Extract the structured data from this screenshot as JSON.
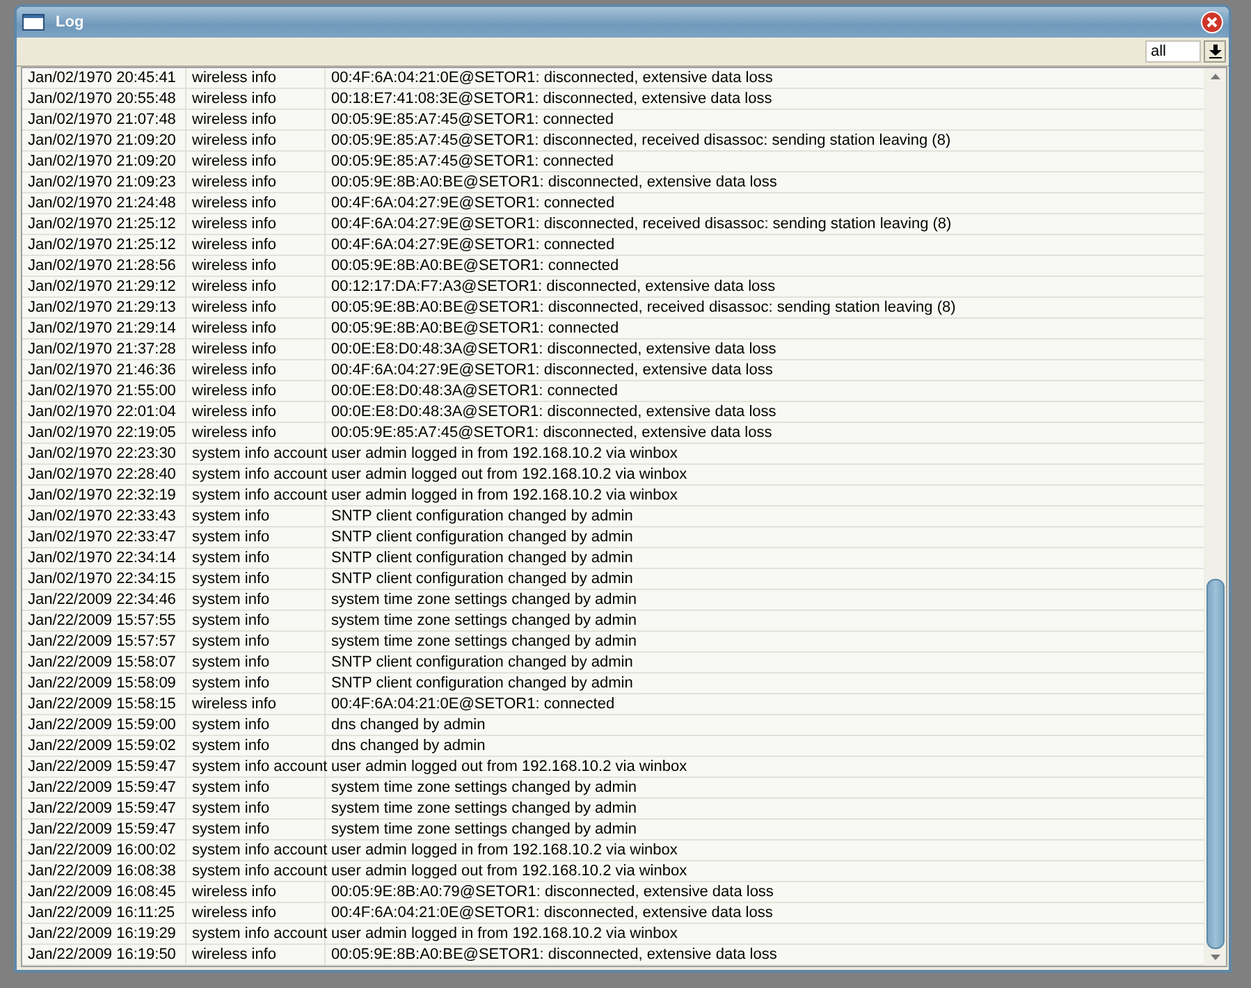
{
  "window": {
    "title": "Log"
  },
  "filter": {
    "value": "all"
  },
  "rows": [
    [
      "Jan/02/1970 20:45:41",
      "wireless info",
      "00:4F:6A:04:21:0E@SETOR1: disconnected, extensive data loss"
    ],
    [
      "Jan/02/1970 20:55:48",
      "wireless info",
      "00:18:E7:41:08:3E@SETOR1: disconnected, extensive data loss"
    ],
    [
      "Jan/02/1970 21:07:48",
      "wireless info",
      "00:05:9E:85:A7:45@SETOR1: connected"
    ],
    [
      "Jan/02/1970 21:09:20",
      "wireless info",
      "00:05:9E:85:A7:45@SETOR1: disconnected, received disassoc: sending station leaving (8)"
    ],
    [
      "Jan/02/1970 21:09:20",
      "wireless info",
      "00:05:9E:85:A7:45@SETOR1: connected"
    ],
    [
      "Jan/02/1970 21:09:23",
      "wireless info",
      "00:05:9E:8B:A0:BE@SETOR1: disconnected, extensive data loss"
    ],
    [
      "Jan/02/1970 21:24:48",
      "wireless info",
      "00:4F:6A:04:27:9E@SETOR1: connected"
    ],
    [
      "Jan/02/1970 21:25:12",
      "wireless info",
      "00:4F:6A:04:27:9E@SETOR1: disconnected, received disassoc: sending station leaving (8)"
    ],
    [
      "Jan/02/1970 21:25:12",
      "wireless info",
      "00:4F:6A:04:27:9E@SETOR1: connected"
    ],
    [
      "Jan/02/1970 21:28:56",
      "wireless info",
      "00:05:9E:8B:A0:BE@SETOR1: connected"
    ],
    [
      "Jan/02/1970 21:29:12",
      "wireless info",
      "00:12:17:DA:F7:A3@SETOR1: disconnected, extensive data loss"
    ],
    [
      "Jan/02/1970 21:29:13",
      "wireless info",
      "00:05:9E:8B:A0:BE@SETOR1: disconnected, received disassoc: sending station leaving (8)"
    ],
    [
      "Jan/02/1970 21:29:14",
      "wireless info",
      "00:05:9E:8B:A0:BE@SETOR1: connected"
    ],
    [
      "Jan/02/1970 21:37:28",
      "wireless info",
      "00:0E:E8:D0:48:3A@SETOR1: disconnected, extensive data loss"
    ],
    [
      "Jan/02/1970 21:46:36",
      "wireless info",
      "00:4F:6A:04:27:9E@SETOR1: disconnected, extensive data loss"
    ],
    [
      "Jan/02/1970 21:55:00",
      "wireless info",
      "00:0E:E8:D0:48:3A@SETOR1: connected"
    ],
    [
      "Jan/02/1970 22:01:04",
      "wireless info",
      "00:0E:E8:D0:48:3A@SETOR1: disconnected, extensive data loss"
    ],
    [
      "Jan/02/1970 22:19:05",
      "wireless info",
      "00:05:9E:85:A7:45@SETOR1: disconnected, extensive data loss"
    ],
    [
      "Jan/02/1970 22:23:30",
      "system info account",
      "user admin logged in from 192.168.10.2 via winbox"
    ],
    [
      "Jan/02/1970 22:28:40",
      "system info account",
      "user admin logged out from 192.168.10.2 via winbox"
    ],
    [
      "Jan/02/1970 22:32:19",
      "system info account",
      "user admin logged in from 192.168.10.2 via winbox"
    ],
    [
      "Jan/02/1970 22:33:43",
      "system info",
      "SNTP client configuration changed by admin"
    ],
    [
      "Jan/02/1970 22:33:47",
      "system info",
      "SNTP client configuration changed by admin"
    ],
    [
      "Jan/02/1970 22:34:14",
      "system info",
      "SNTP client configuration changed by admin"
    ],
    [
      "Jan/02/1970 22:34:15",
      "system info",
      "SNTP client configuration changed by admin"
    ],
    [
      "Jan/22/2009 22:34:46",
      "system info",
      "system time zone settings changed by admin"
    ],
    [
      "Jan/22/2009 15:57:55",
      "system info",
      "system time zone settings changed by admin"
    ],
    [
      "Jan/22/2009 15:57:57",
      "system info",
      "system time zone settings changed by admin"
    ],
    [
      "Jan/22/2009 15:58:07",
      "system info",
      "SNTP client configuration changed by admin"
    ],
    [
      "Jan/22/2009 15:58:09",
      "system info",
      "SNTP client configuration changed by admin"
    ],
    [
      "Jan/22/2009 15:58:15",
      "wireless info",
      "00:4F:6A:04:21:0E@SETOR1: connected"
    ],
    [
      "Jan/22/2009 15:59:00",
      "system info",
      "dns changed by admin"
    ],
    [
      "Jan/22/2009 15:59:02",
      "system info",
      "dns changed by admin"
    ],
    [
      "Jan/22/2009 15:59:47",
      "system info account",
      "user admin logged out from 192.168.10.2 via winbox"
    ],
    [
      "Jan/22/2009 15:59:47",
      "system info",
      "system time zone settings changed by admin"
    ],
    [
      "Jan/22/2009 15:59:47",
      "system info",
      "system time zone settings changed by admin"
    ],
    [
      "Jan/22/2009 15:59:47",
      "system info",
      "system time zone settings changed by admin"
    ],
    [
      "Jan/22/2009 16:00:02",
      "system info account",
      "user admin logged in from 192.168.10.2 via winbox"
    ],
    [
      "Jan/22/2009 16:08:38",
      "system info account",
      "user admin logged out from 192.168.10.2 via winbox"
    ],
    [
      "Jan/22/2009 16:08:45",
      "wireless info",
      "00:05:9E:8B:A0:79@SETOR1: disconnected, extensive data loss"
    ],
    [
      "Jan/22/2009 16:11:25",
      "wireless info",
      "00:4F:6A:04:21:0E@SETOR1: disconnected, extensive data loss"
    ],
    [
      "Jan/22/2009 16:19:29",
      "system info account",
      "user admin logged in from 192.168.10.2 via winbox"
    ],
    [
      "Jan/22/2009 16:19:50",
      "wireless info",
      "00:05:9E:8B:A0:BE@SETOR1: disconnected, extensive data loss"
    ]
  ]
}
